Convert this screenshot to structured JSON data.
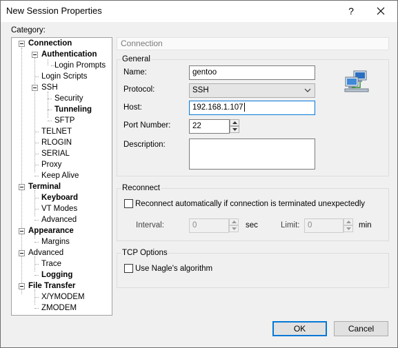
{
  "window": {
    "title": "New Session Properties",
    "help_glyph": "?"
  },
  "category": {
    "label": "Category:",
    "tree": [
      {
        "label": "Connection",
        "bold": true
      },
      {
        "label": "Authentication",
        "bold": true
      },
      {
        "label": "Login Prompts",
        "bold": false
      },
      {
        "label": "Login Scripts",
        "bold": false
      },
      {
        "label": "SSH",
        "bold": false
      },
      {
        "label": "Security",
        "bold": false
      },
      {
        "label": "Tunneling",
        "bold": true
      },
      {
        "label": "SFTP",
        "bold": false
      },
      {
        "label": "TELNET",
        "bold": false
      },
      {
        "label": "RLOGIN",
        "bold": false
      },
      {
        "label": "SERIAL",
        "bold": false
      },
      {
        "label": "Proxy",
        "bold": false
      },
      {
        "label": "Keep Alive",
        "bold": false
      },
      {
        "label": "Terminal",
        "bold": true
      },
      {
        "label": "Keyboard",
        "bold": true
      },
      {
        "label": "VT Modes",
        "bold": false
      },
      {
        "label": "Advanced",
        "bold": false
      },
      {
        "label": "Appearance",
        "bold": true
      },
      {
        "label": "Margins",
        "bold": false
      },
      {
        "label": "Advanced",
        "bold": false
      },
      {
        "label": "Trace",
        "bold": false
      },
      {
        "label": "Logging",
        "bold": true
      },
      {
        "label": "File Transfer",
        "bold": true
      },
      {
        "label": "X/YMODEM",
        "bold": false
      },
      {
        "label": "ZMODEM",
        "bold": false
      }
    ]
  },
  "panel": {
    "header": "Connection",
    "general": {
      "title": "General",
      "name_label": "Name:",
      "name_value": "gentoo",
      "protocol_label": "Protocol:",
      "protocol_value": "SSH",
      "host_label": "Host:",
      "host_value": "192.168.1.107",
      "port_label": "Port Number:",
      "port_value": "22",
      "description_label": "Description:",
      "description_value": ""
    },
    "reconnect": {
      "title": "Reconnect",
      "checkbox_label": "Reconnect automatically if connection is terminated unexpectedly",
      "checked": false,
      "interval_label": "Interval:",
      "interval_value": "0",
      "interval_unit": "sec",
      "limit_label": "Limit:",
      "limit_value": "0",
      "limit_unit": "min"
    },
    "tcp": {
      "title": "TCP Options",
      "nagle_label": "Use Nagle's algorithm",
      "checked": false
    }
  },
  "buttons": {
    "ok": "OK",
    "cancel": "Cancel"
  },
  "colors": {
    "accent": "#0078d7",
    "border": "#adadad",
    "background": "#f0f0f0"
  },
  "icons": {
    "network": "network-computers-icon",
    "close": "close-icon",
    "help": "help-icon"
  }
}
